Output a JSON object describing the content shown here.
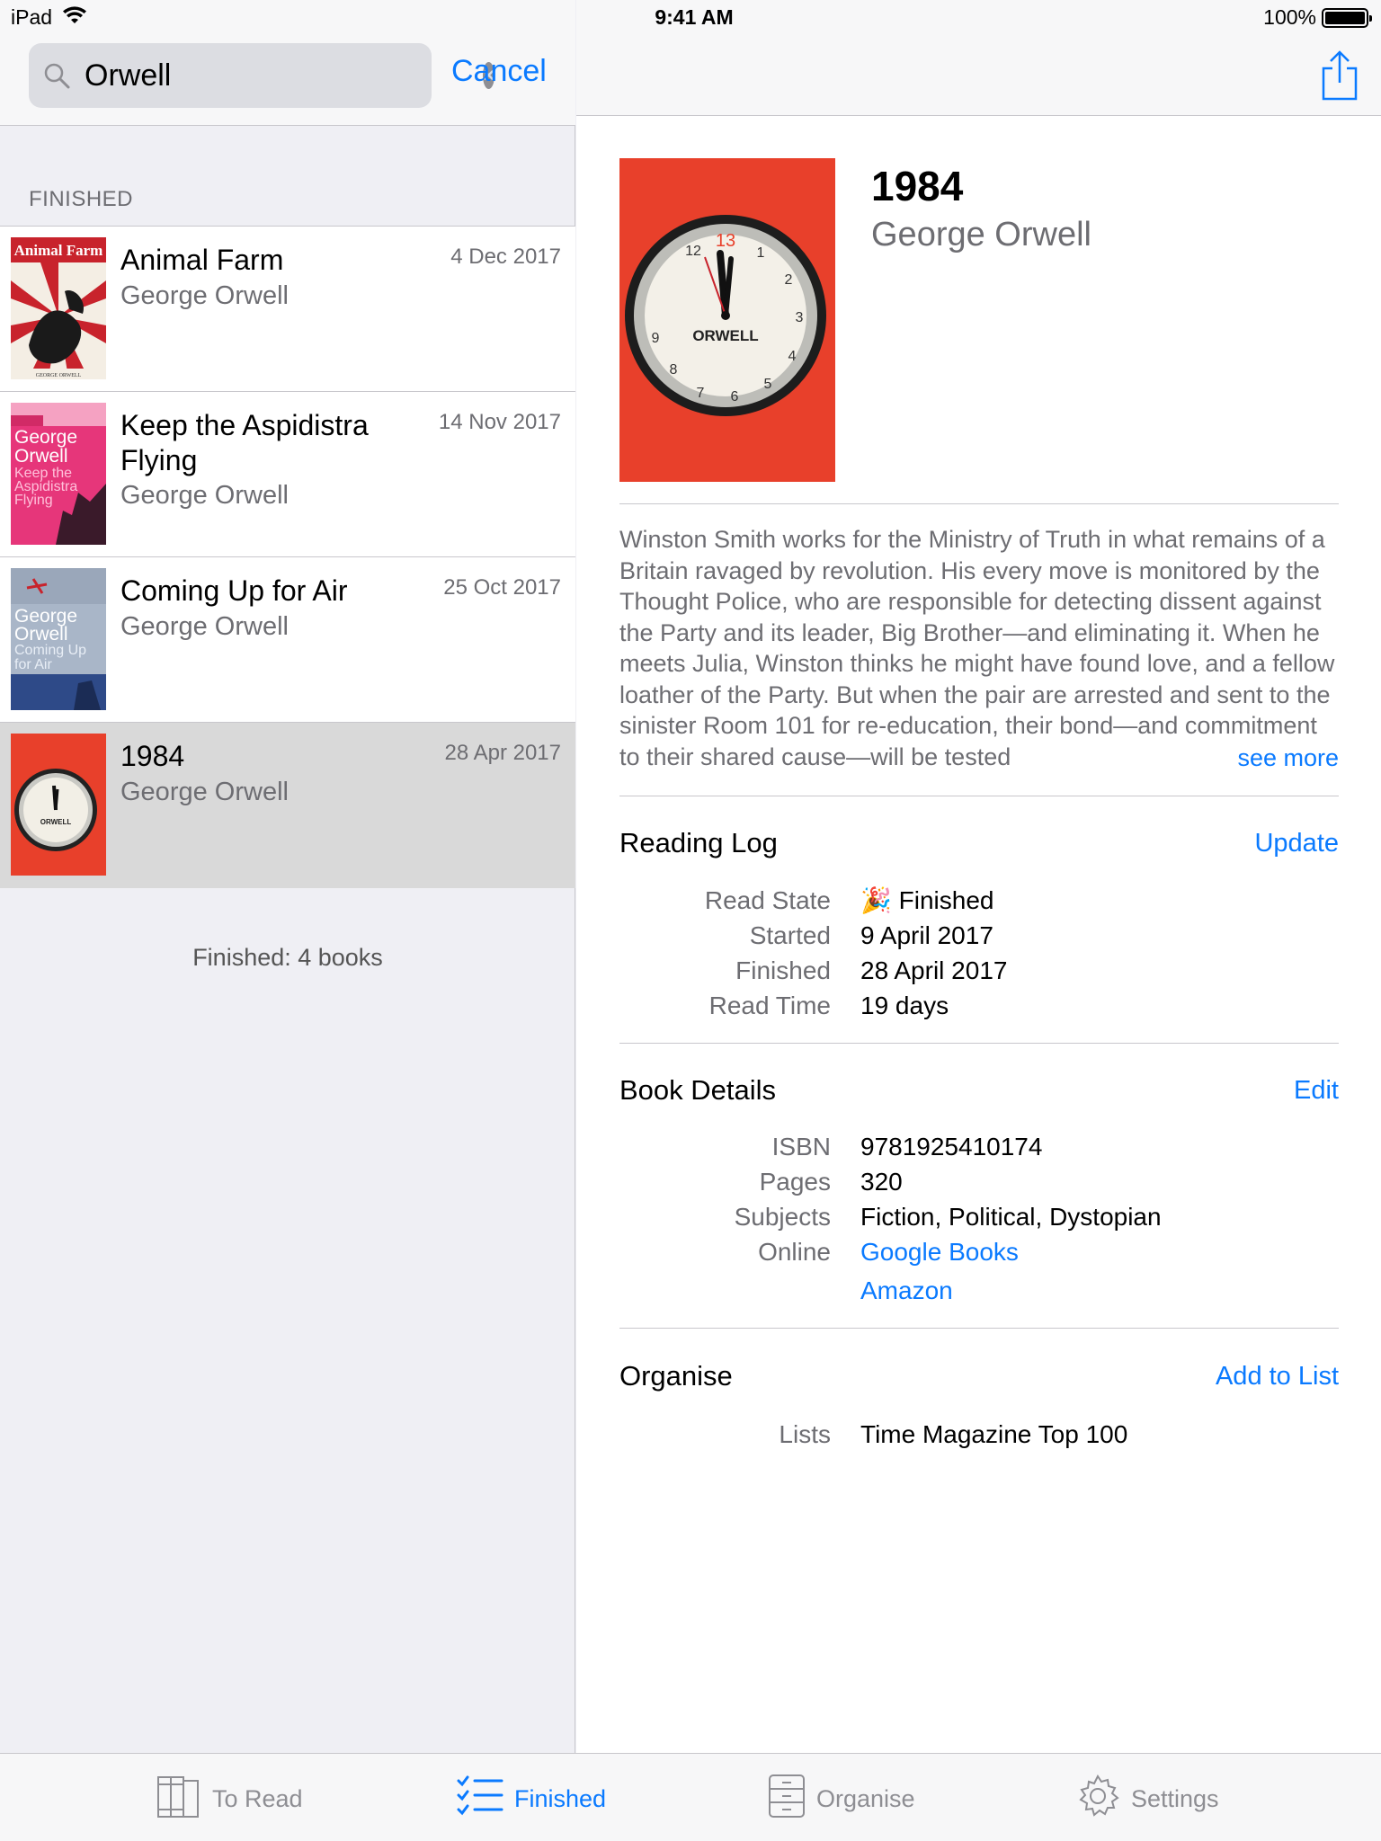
{
  "status_bar": {
    "device": "iPad",
    "time": "9:41 AM",
    "battery": "100%"
  },
  "search": {
    "query": "Orwell",
    "cancel_label": "Cancel"
  },
  "list": {
    "section_header": "FINISHED",
    "books": [
      {
        "title": "Animal Farm",
        "author": "George Orwell",
        "date": "4 Dec 2017"
      },
      {
        "title": "Keep the Aspidistra Flying",
        "author": "George Orwell",
        "date": "14 Nov 2017"
      },
      {
        "title": "Coming Up for Air",
        "author": "George Orwell",
        "date": "25 Oct 2017"
      },
      {
        "title": "1984",
        "author": "George Orwell",
        "date": "28 Apr 2017"
      }
    ],
    "footer": "Finished: 4 books"
  },
  "detail": {
    "title": "1984",
    "author": "George Orwell",
    "description": "Winston Smith works for the Ministry of Truth in what remains of a Britain ravaged by revolution. His every move is monitored by the Thought Police, who are responsible for detecting dissent against the Party and its leader, Big Brother—and eliminating it. When he meets Julia, Winston thinks he might have found love, and a fellow loather of the Party. But when the pair are arrested and sent to the sinister Room 101 for re-education, their bond—and commitment to their shared cause—will be tested",
    "see_more": "see more",
    "reading_log": {
      "title": "Reading Log",
      "action": "Update",
      "rows": [
        {
          "key": "Read State",
          "value": "🎉 Finished"
        },
        {
          "key": "Started",
          "value": "9 April 2017"
        },
        {
          "key": "Finished",
          "value": "28 April 2017"
        },
        {
          "key": "Read Time",
          "value": "19 days"
        }
      ]
    },
    "book_details": {
      "title": "Book Details",
      "action": "Edit",
      "rows": [
        {
          "key": "ISBN",
          "value": "9781925410174"
        },
        {
          "key": "Pages",
          "value": "320"
        },
        {
          "key": "Subjects",
          "value": "Fiction, Political, Dystopian"
        },
        {
          "key": "Online",
          "value": "Google Books"
        },
        {
          "key": "",
          "value": "Amazon"
        }
      ]
    },
    "organise": {
      "title": "Organise",
      "action": "Add to List",
      "rows": [
        {
          "key": "Lists",
          "value": "Time Magazine Top 100"
        }
      ]
    }
  },
  "tabs": [
    {
      "label": "To Read",
      "icon": "books-icon"
    },
    {
      "label": "Finished",
      "icon": "checklist-icon",
      "active": true
    },
    {
      "label": "Organise",
      "icon": "cabinet-icon"
    },
    {
      "label": "Settings",
      "icon": "gear-icon"
    }
  ],
  "colors": {
    "accent": "#0a7aff",
    "selected_row": "#d9d9d9",
    "cover_red": "#e8402b"
  }
}
